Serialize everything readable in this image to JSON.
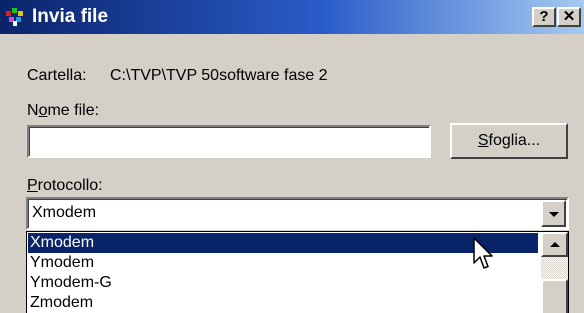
{
  "window": {
    "title": "Invia file",
    "help_button": "?",
    "close_button": "✕"
  },
  "folder": {
    "label": "Cartella:",
    "path": "C:\\TVP\\TVP 50software fase 2"
  },
  "filename": {
    "label_pre": "N",
    "label_accel": "o",
    "label_post": "me file:",
    "value": ""
  },
  "browse_button": {
    "label_accel": "S",
    "label_rest": "foglia..."
  },
  "protocol": {
    "label_accel": "P",
    "label_rest": "rotocollo:",
    "selected": "Xmodem",
    "options": [
      "Xmodem",
      "Ymodem",
      "Ymodem-G",
      "Zmodem"
    ],
    "highlighted_index": 0
  },
  "colors": {
    "title_gradient_start": "#0a246a",
    "title_gradient_end": "#a6caf0",
    "face": "#d4d0c8",
    "selection": "#0a246a"
  },
  "icons": {
    "app": "hyperterminal-icon",
    "cursor": "mouse-pointer-icon"
  }
}
